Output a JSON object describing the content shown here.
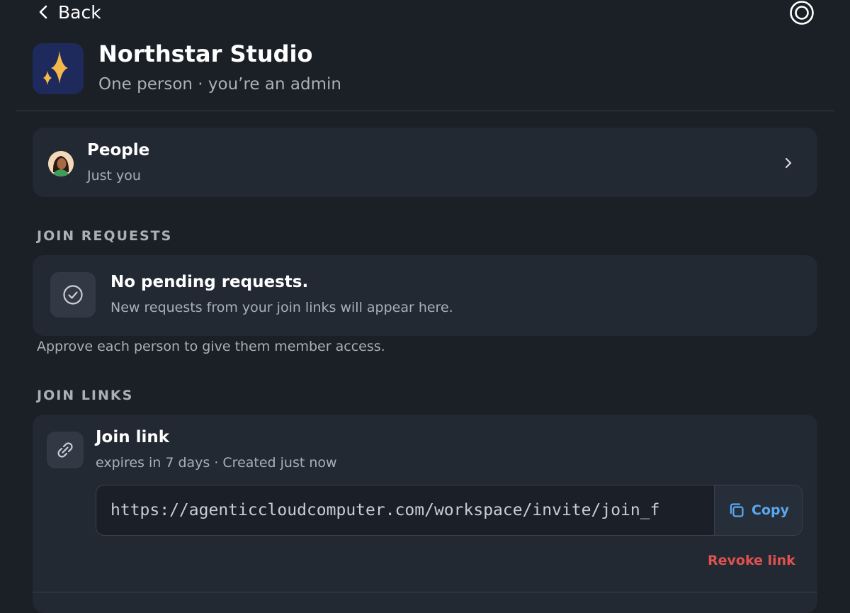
{
  "nav": {
    "back_label": "Back",
    "settings_icon": "settings-ring-icon"
  },
  "workspace": {
    "name": "Northstar Studio",
    "subtitle": "One person · you’re an admin",
    "logo_icon": "sparkle-icon",
    "logo_bg": "#1f2a5c",
    "logo_accent": "#f2b84b"
  },
  "people": {
    "title": "People",
    "subtitle": "Just you"
  },
  "join_requests": {
    "section_label": "JOIN REQUESTS",
    "empty_title": "No pending requests.",
    "empty_subtitle": "New requests from your join links will appear here.",
    "note": "Approve each person to give them member access."
  },
  "join_links": {
    "section_label": "JOIN LINKS",
    "items": [
      {
        "title": "Join link",
        "meta": "expires in 7 days · Created just now",
        "url": "https://agenticcloudcomputer.com/workspace/invite/join_f",
        "copy_label": "Copy",
        "revoke_label": "Revoke link"
      }
    ]
  },
  "colors": {
    "background": "#1b1f26",
    "card": "#222933",
    "accent": "#5aa7ef",
    "danger": "#e0524f",
    "muted_text": "#aab0b9"
  }
}
